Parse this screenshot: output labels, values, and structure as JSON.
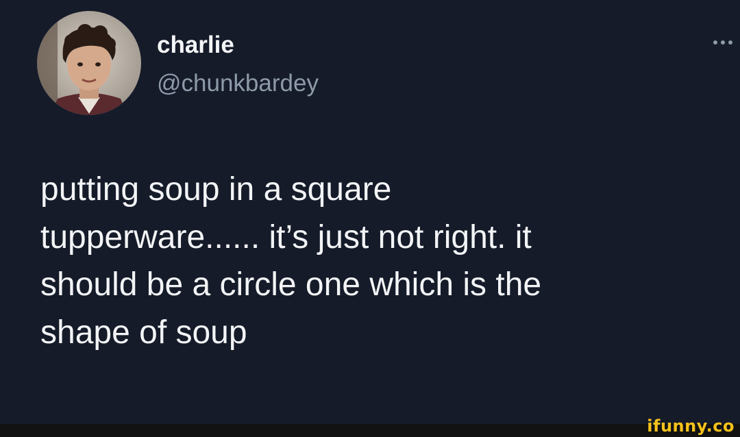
{
  "tweet": {
    "display_name": "charlie",
    "handle": "@chunkbardey",
    "text": "putting soup in a square\ntupperware...... it’s just not right. it\nshould be a circle one which is the\nshape of soup",
    "more_icon": "more-horizontal-icon",
    "avatar_icon": "profile-photo"
  },
  "watermark": {
    "text": "ifunny.co",
    "color": "#f6c21c"
  },
  "colors": {
    "background": "#151b29",
    "text": "#f3f4f6",
    "handle": "#8e9aa9",
    "footer": "#121212"
  }
}
